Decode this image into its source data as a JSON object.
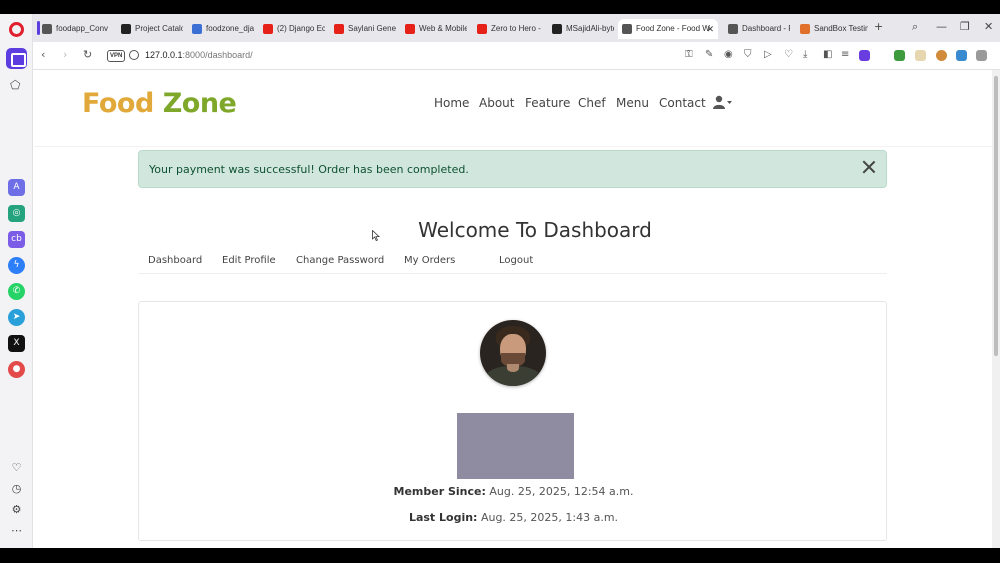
{
  "browser": {
    "tabs": [
      {
        "label": "foodapp_Conv",
        "color": "#555555"
      },
      {
        "label": "Project Catalo",
        "color": "#222222"
      },
      {
        "label": "foodzone_djan",
        "color": "#3b6fd4"
      },
      {
        "label": "(2) Django Eco",
        "color": "#e62117"
      },
      {
        "label": "Saylani Genera",
        "color": "#e62117"
      },
      {
        "label": "Web & Mobile",
        "color": "#e62117"
      },
      {
        "label": "Zero to Hero -",
        "color": "#e62117"
      },
      {
        "label": "MSajidAli-byte",
        "color": "#222222"
      },
      {
        "label": "Food Zone - Food W",
        "color": "#555555"
      },
      {
        "label": "Dashboard - F",
        "color": "#555555"
      },
      {
        "label": "SandBox Testin",
        "color": "#e0702a"
      }
    ],
    "url_host": "127.0.0.1",
    "url_path": ":8000/dashboard/",
    "vpn_label": "VPN"
  },
  "site": {
    "brand_part1": "Food ",
    "brand_part2": "Zone",
    "nav": [
      "Home",
      "About",
      "Feature",
      "Chef",
      "Menu",
      "Contact"
    ],
    "brand_colors": {
      "food": "#e0a93a",
      "zone": "#7fa82a"
    }
  },
  "alert": {
    "message": "Your payment was successful! Order has been completed."
  },
  "dashboard": {
    "title": "Welcome To Dashboard",
    "menu": [
      "Dashboard",
      "Edit Profile",
      "Change Password",
      "My Orders",
      "Logout"
    ],
    "member_since_label": "Member Since:",
    "member_since_value": "Aug. 25, 2025, 12:54 a.m.",
    "last_login_label": "Last Login:",
    "last_login_value": "Aug. 25, 2025, 1:43 a.m."
  }
}
